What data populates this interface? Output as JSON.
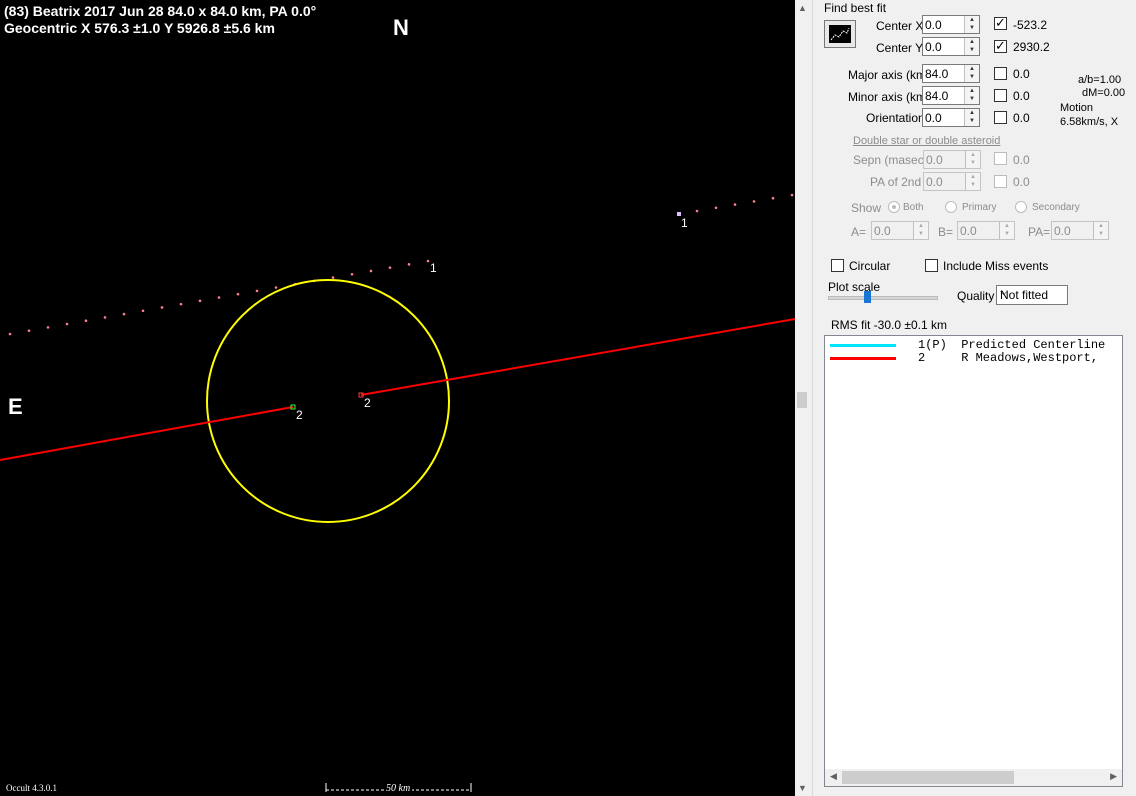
{
  "plot": {
    "header_line1": "(83) Beatrix  2017 Jun 28   84.0 x 84.0 km,  PA 0.0°",
    "header_line2": "Geocentric  X  576.3 ±1.0  Y 5926.8 ±5.6 km",
    "north_label": "N",
    "east_label": "E",
    "version": "Occult 4.3.0.1",
    "scale_label": "50 km",
    "markers": [
      "1",
      "1",
      "2",
      "2"
    ],
    "colors": {
      "background": "#000000",
      "ellipse": "#ffff00",
      "chord": "#ff0000",
      "path_dots": "#ff7f8f"
    }
  },
  "panel": {
    "find_best_fit": "Find best fit",
    "center_x": {
      "label": "Center X",
      "value": "0.0",
      "checked": true,
      "result": "-523.2"
    },
    "center_y": {
      "label": "Center Y",
      "value": "0.0",
      "checked": true,
      "result": "2930.2"
    },
    "major_axis": {
      "label": "Major axis (km)",
      "value": "84.0",
      "checked": false,
      "result": "0.0"
    },
    "minor_axis": {
      "label": "Minor axis (km)",
      "value": "84.0",
      "checked": false,
      "result": "0.0"
    },
    "orientation": {
      "label": "Orientation",
      "value": "0.0",
      "checked": false,
      "result": "0.0"
    },
    "ab_ratio": "a/b=1.00",
    "dm": "dM=0.00",
    "motion_label": "Motion",
    "motion_value": "6.58km/s, X",
    "double_star_link": "Double star  or  double asteroid",
    "sepn": {
      "label": "Sepn (masec)",
      "value": "0.0",
      "result": "0.0"
    },
    "pa2nd": {
      "label": "PA of 2nd",
      "value": "0.0",
      "result": "0.0"
    },
    "show_label": "Show",
    "show_options": [
      "Both",
      "Primary",
      "Secondary"
    ],
    "a_label": "A=",
    "a_value": "0.0",
    "b_label": "B=",
    "b_value": "0.0",
    "pa_label": "PA=",
    "pa_value": "0.0",
    "circular_label": "Circular",
    "include_miss_label": "Include Miss events",
    "plot_scale_label": "Plot scale",
    "quality_label": "Quality",
    "quality_value": "Not fitted",
    "rms_fit": "RMS fit -30.0 ±0.1 km",
    "chords": [
      {
        "color": "#00e5ff",
        "text": "1(P)  Predicted Centerline"
      },
      {
        "color": "#ff0000",
        "text": "2     R Meadows,Westport,"
      }
    ]
  }
}
